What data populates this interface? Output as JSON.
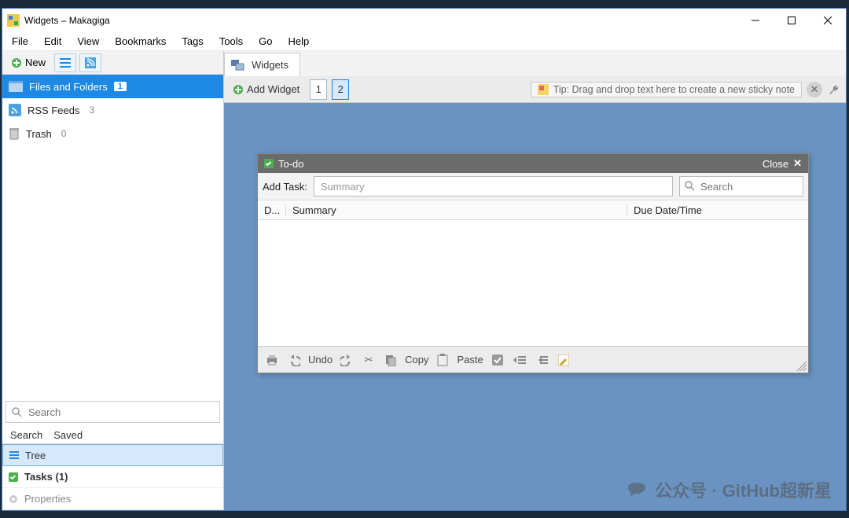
{
  "window": {
    "title": "Widgets – Makagiga"
  },
  "menu": {
    "file": "File",
    "edit": "Edit",
    "view": "View",
    "bookmarks": "Bookmarks",
    "tags": "Tags",
    "tools": "Tools",
    "go": "Go",
    "help": "Help"
  },
  "sidebar": {
    "toolbar": {
      "new_label": "New"
    },
    "items": [
      {
        "label": "Files and Folders",
        "badge": "1",
        "selected": true
      },
      {
        "label": "RSS Feeds",
        "count": "3"
      },
      {
        "label": "Trash",
        "count": "0"
      }
    ],
    "search_placeholder": "Search",
    "filter_tabs": {
      "search": "Search",
      "saved": "Saved"
    },
    "nav": {
      "tree": "Tree",
      "tasks": "Tasks (1)",
      "properties": "Properties"
    }
  },
  "main": {
    "tab_label": "Widgets",
    "addwidget": "Add Widget",
    "pager": {
      "p1": "1",
      "p2": "2",
      "active": 2
    },
    "tip": "Tip: Drag and drop text here to create a new sticky note"
  },
  "todo": {
    "title": "To-do",
    "close": "Close",
    "addtask_label": "Add Task:",
    "summary_placeholder": "Summary",
    "search_placeholder": "Search",
    "columns": {
      "done": "D...",
      "summary": "Summary",
      "due": "Due Date/Time"
    },
    "toolbar": {
      "undo": "Undo",
      "copy": "Copy",
      "paste": "Paste"
    }
  },
  "watermark": "公众号 · GitHub超新星"
}
